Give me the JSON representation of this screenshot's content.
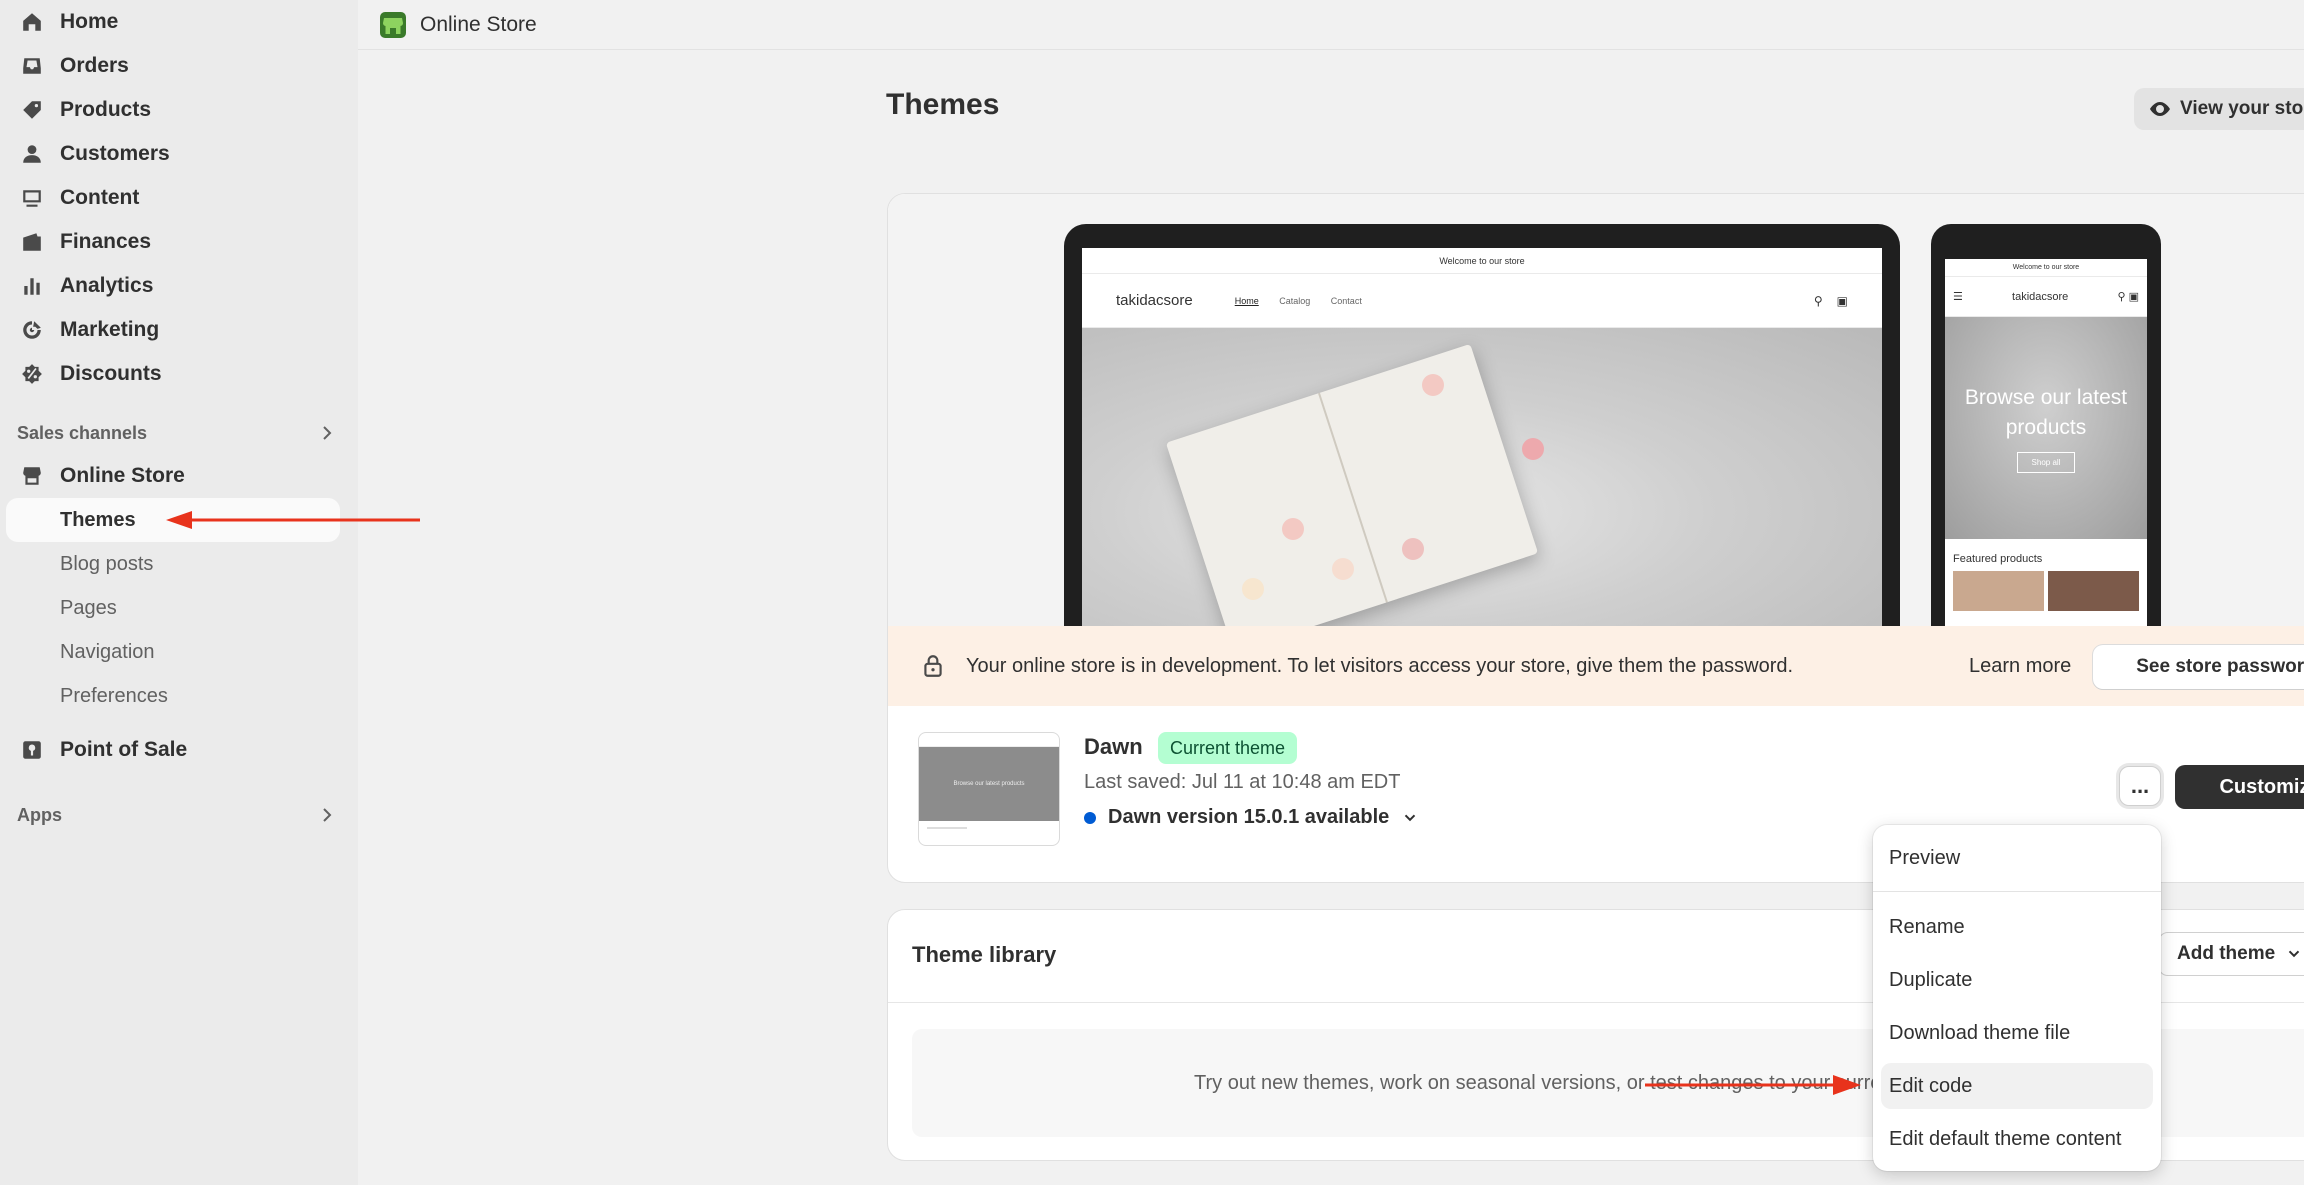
{
  "sidebar": {
    "items": [
      {
        "label": "Home",
        "icon": "home-icon"
      },
      {
        "label": "Orders",
        "icon": "inbox-icon"
      },
      {
        "label": "Products",
        "icon": "tag-icon"
      },
      {
        "label": "Customers",
        "icon": "person-icon"
      },
      {
        "label": "Content",
        "icon": "content-icon"
      },
      {
        "label": "Finances",
        "icon": "wallet-icon"
      },
      {
        "label": "Analytics",
        "icon": "bar-chart-icon"
      },
      {
        "label": "Marketing",
        "icon": "target-icon"
      },
      {
        "label": "Discounts",
        "icon": "discount-icon"
      }
    ],
    "sales_channels_label": "Sales channels",
    "online_store_label": "Online Store",
    "online_store_sub": [
      "Themes",
      "Blog posts",
      "Pages",
      "Navigation",
      "Preferences"
    ],
    "pos_label": "Point of Sale",
    "apps_label": "Apps"
  },
  "topbar": {
    "title": "Online Store"
  },
  "page": {
    "title": "Themes",
    "view_store_label": "View your store"
  },
  "preview": {
    "announcement": "Welcome to our store",
    "store_name": "takidacsore",
    "menu": [
      "Home",
      "Catalog",
      "Contact"
    ],
    "phone_hero_title": "Browse our latest products",
    "phone_hero_button": "Shop all",
    "phone_featured": "Featured products"
  },
  "banner": {
    "message": "Your online store is in development. To let visitors access your store, give them the password.",
    "learn_more": "Learn more",
    "store_password_button": "See store password"
  },
  "current_theme": {
    "name": "Dawn",
    "badge": "Current theme",
    "last_saved": "Last saved: Jul 11 at 10:48 am EDT",
    "version": "Dawn version 15.0.1 available",
    "more_label": "...",
    "customize_label": "Customize",
    "thumb_text": "Browse our latest products"
  },
  "library": {
    "title": "Theme library",
    "add_theme_label": "Add theme",
    "empty_text": "Try out new themes, work on seasonal versions, or test changes to your current theme."
  },
  "dropdown": {
    "items": [
      "Preview",
      "Rename",
      "Duplicate",
      "Download theme file",
      "Edit code",
      "Edit default theme content"
    ]
  },
  "colors": {
    "annotation_arrow": "#e8331c",
    "badge_bg": "#b4fed2",
    "primary_button": "#303030"
  }
}
